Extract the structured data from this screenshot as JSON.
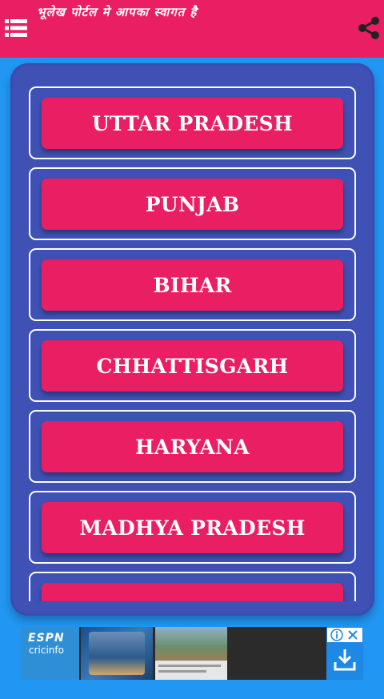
{
  "header": {
    "title": "भूलेख पोर्टल मे आपका स्वागत है",
    "menu_icon": "list-menu-icon",
    "share_icon": "share-icon",
    "color": "#e91e63"
  },
  "states": [
    {
      "label": "UTTAR PRADESH"
    },
    {
      "label": "PUNJAB"
    },
    {
      "label": "BIHAR"
    },
    {
      "label": "CHHATTISGARH"
    },
    {
      "label": "HARYANA"
    },
    {
      "label": "MADHYA PRADESH"
    },
    {
      "label": ""
    }
  ],
  "ad": {
    "logo_top": "ESPN",
    "logo_bottom": "cricinfo",
    "info_icon": "info-icon",
    "close_icon": "close-icon",
    "download_icon": "download-icon"
  },
  "colors": {
    "background": "#2196f3",
    "panel": "#3f51b5",
    "button": "#e91e63"
  }
}
